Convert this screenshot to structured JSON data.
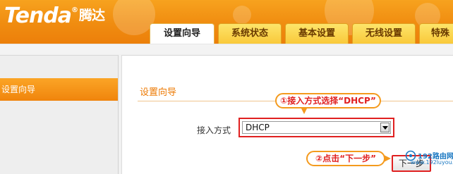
{
  "brand": {
    "name": "Tenda",
    "registered": "®",
    "cn_name": "腾达"
  },
  "tabs": [
    {
      "label": "设置向导",
      "active": true
    },
    {
      "label": "系统状态",
      "active": false
    },
    {
      "label": "基本设置",
      "active": false
    },
    {
      "label": "无线设置",
      "active": false
    },
    {
      "label": "特殊",
      "active": false
    }
  ],
  "sidebar": {
    "items": [
      {
        "label": "设置向导",
        "active": true
      }
    ]
  },
  "main": {
    "section_title": "设置向导",
    "access_label": "接入方式",
    "access_value": "DHCP",
    "next_label": "下一步"
  },
  "annotations": {
    "step1": "①接入方式选择“DHCP”",
    "step2": "②点击“下一步”"
  },
  "watermark": {
    "brand": "192路由网",
    "url": "www.192luyou.com"
  },
  "colors": {
    "header_orange": "#f08c10",
    "tab_yellow": "#f9c93a",
    "accent_orange": "#ed7b06",
    "highlight_red": "#e02020"
  }
}
